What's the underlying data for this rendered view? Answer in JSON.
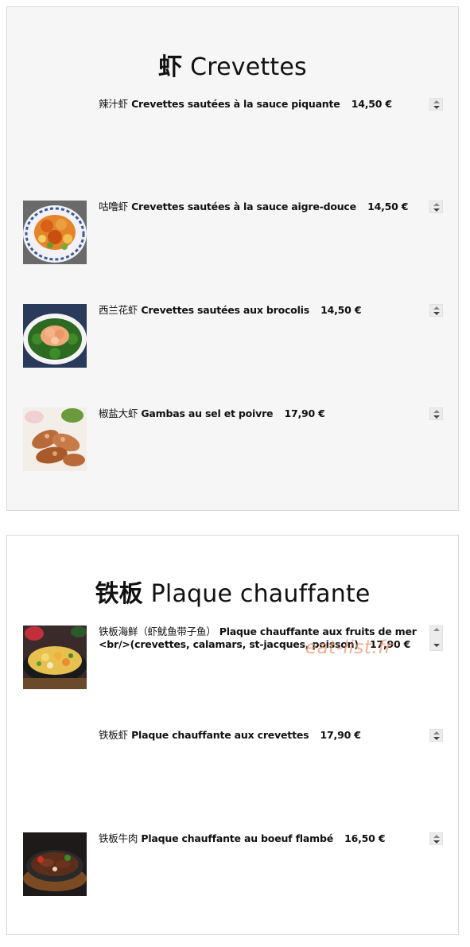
{
  "sections": [
    {
      "title_cn": "虾",
      "title_fr": "Crevettes",
      "items": [
        {
          "name_cn": "辣汁虾",
          "name_fr": "Crevettes sautées à la sauce piquante",
          "price": "14,50 €"
        },
        {
          "name_cn": "咕噜虾",
          "name_fr": "Crevettes sautées à la sauce aigre-douce",
          "price": "14,50 €"
        },
        {
          "name_cn": "西兰花虾",
          "name_fr": "Crevettes sautées aux brocolis",
          "price": "14,50 €"
        },
        {
          "name_cn": "椒盐大虾",
          "name_fr": "Gambas au sel et poivre",
          "price": "17,90 €"
        }
      ]
    },
    {
      "title_cn": "铁板",
      "title_fr": "Plaque chauffante",
      "items": [
        {
          "name_cn": "铁板海鲜（虾鱿鱼带子鱼）",
          "name_fr": "Plaque chauffante aux fruits de mer <br/>(crevettes, calamars, st-jacques, poisson)",
          "price": "17,90 €"
        },
        {
          "name_cn": "铁板虾",
          "name_fr": "Plaque chauffante aux crevettes",
          "price": "17,90 €"
        },
        {
          "name_cn": "铁板牛肉",
          "name_fr": "Plaque chauffante au boeuf flambé",
          "price": "16,50 €"
        }
      ]
    }
  ],
  "watermark": "eat-list.fr"
}
